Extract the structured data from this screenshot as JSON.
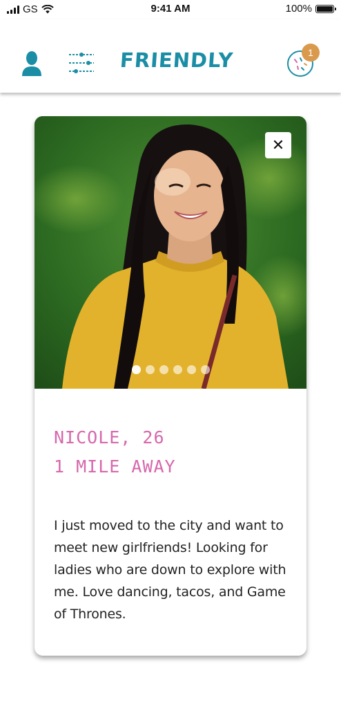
{
  "status_bar": {
    "carrier": "GS",
    "time": "9:41 AM",
    "battery_text": "100%",
    "battery_level": 1.0
  },
  "nav": {
    "logo": "FRIENDLY",
    "notification_count": "1",
    "icons": {
      "profile": "profile-icon",
      "filter": "filter-sliders-icon",
      "messages": "sprinkle-donut-icon"
    }
  },
  "colors": {
    "brand": "#1b8ea6",
    "accent_pink": "#d668ac",
    "badge": "#d99a4e"
  },
  "card": {
    "name_age": "NICOLE, 26",
    "distance": "1 MILE AWAY",
    "bio": "I just moved to the city and want to meet new girlfriends!  Looking for ladies who are down to explore with me.  Love dancing, tacos, and Game of Thrones.",
    "photo_count": 6,
    "active_photo_index": 0
  }
}
